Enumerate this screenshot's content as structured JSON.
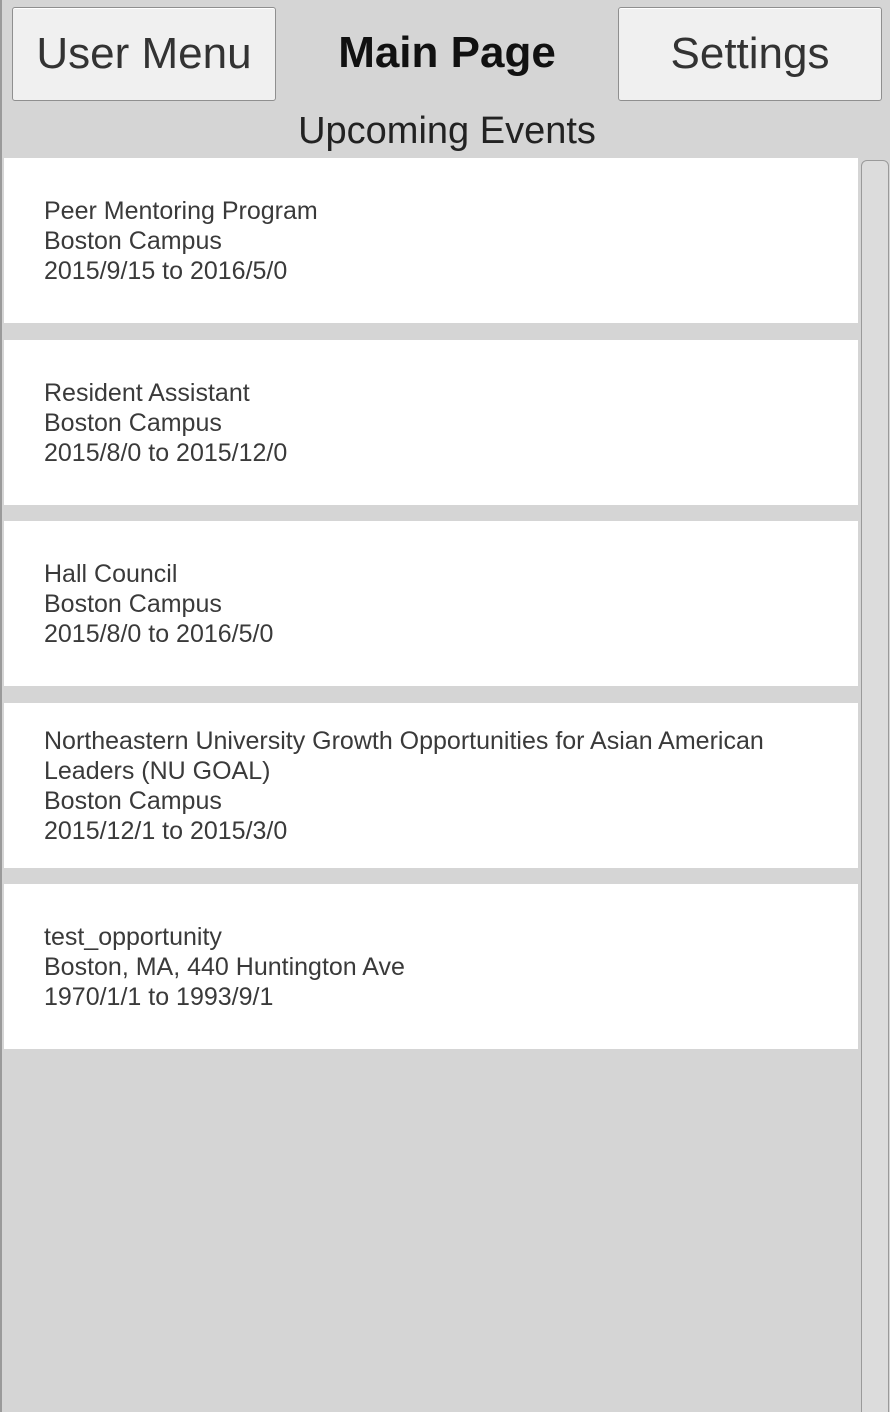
{
  "header": {
    "user_menu_label": "User Menu",
    "page_title": "Main Page",
    "settings_label": "Settings"
  },
  "section": {
    "title": "Upcoming Events"
  },
  "events": [
    {
      "title": "Peer Mentoring Program",
      "location": "Boston Campus",
      "dates": "2015/9/15 to 2016/5/0"
    },
    {
      "title": "Resident Assistant",
      "location": "Boston Campus",
      "dates": "2015/8/0 to 2015/12/0"
    },
    {
      "title": "Hall Council",
      "location": "Boston Campus",
      "dates": "2015/8/0 to 2016/5/0"
    },
    {
      "title": "Northeastern University Growth Opportunities for Asian American Leaders (NU GOAL)",
      "location": "Boston Campus",
      "dates": "2015/12/1 to 2015/3/0"
    },
    {
      "title": "test_opportunity",
      "location": "Boston, MA, 440 Huntington Ave",
      "dates": "1970/1/1 to 1993/9/1"
    }
  ]
}
